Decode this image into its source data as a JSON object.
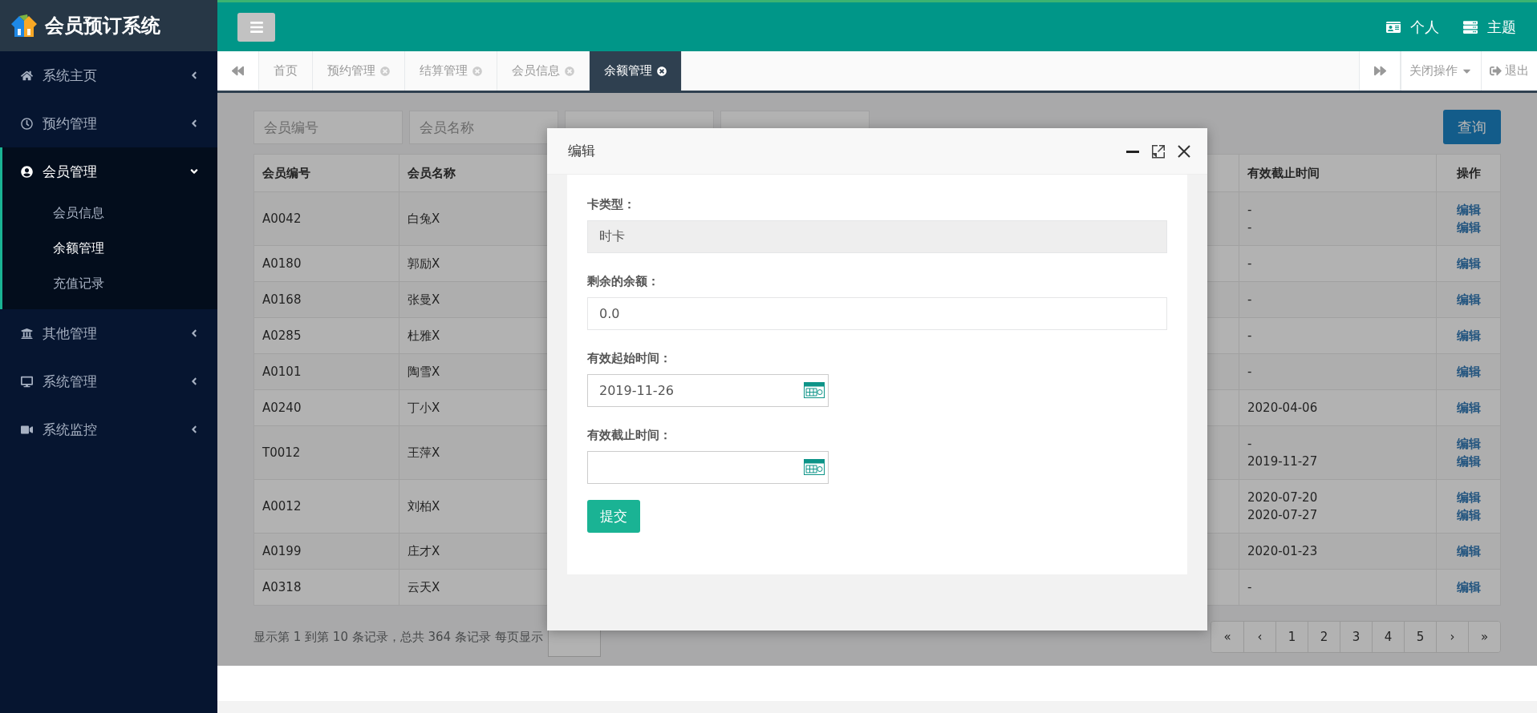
{
  "app": {
    "title": "会员预订系统"
  },
  "header": {
    "actions": [
      {
        "label": "个人"
      },
      {
        "label": "主题"
      }
    ]
  },
  "sidebar": {
    "items": [
      {
        "label": "系统主页",
        "expanded": false
      },
      {
        "label": "预约管理",
        "expanded": false
      },
      {
        "label": "会员管理",
        "expanded": true,
        "children": [
          {
            "label": "会员信息",
            "selected": false
          },
          {
            "label": "余额管理",
            "selected": true
          },
          {
            "label": "充值记录",
            "selected": false
          }
        ]
      },
      {
        "label": "其他管理",
        "expanded": false
      },
      {
        "label": "系统管理",
        "expanded": false
      },
      {
        "label": "系统监控",
        "expanded": false
      }
    ]
  },
  "tabs": [
    {
      "label": "首页",
      "closable": false,
      "selected": false
    },
    {
      "label": "预约管理",
      "closable": true,
      "selected": false
    },
    {
      "label": "结算管理",
      "closable": true,
      "selected": false
    },
    {
      "label": "会员信息",
      "closable": true,
      "selected": false
    },
    {
      "label": "余额管理",
      "closable": true,
      "selected": true
    }
  ],
  "tab_tools": {
    "close_menu": "关闭操作",
    "logout": "退出"
  },
  "search": {
    "fields": [
      {
        "placeholder": "会员编号"
      },
      {
        "placeholder": "会员名称"
      }
    ],
    "button": "查询"
  },
  "table": {
    "columns": [
      "会员编号",
      "会员名称",
      "有效截止时间",
      "操作"
    ],
    "rows": [
      {
        "id": "A0042",
        "name": "白兔X",
        "end_dates": [
          "-",
          "-"
        ],
        "actions": [
          "编辑",
          "编辑"
        ]
      },
      {
        "id": "A0180",
        "name": "郭励X",
        "end_dates": [
          "-"
        ],
        "actions": [
          "编辑"
        ]
      },
      {
        "id": "A0168",
        "name": "张曼X",
        "end_dates": [
          "-"
        ],
        "actions": [
          "编辑"
        ]
      },
      {
        "id": "A0285",
        "name": "杜雅X",
        "end_dates": [
          "-"
        ],
        "actions": [
          "编辑"
        ]
      },
      {
        "id": "A0101",
        "name": "陶雪X",
        "end_dates": [
          "-"
        ],
        "actions": [
          "编辑"
        ]
      },
      {
        "id": "A0240",
        "name": "丁小X",
        "end_dates": [
          "2020-04-06"
        ],
        "actions": [
          "编辑"
        ]
      },
      {
        "id": "T0012",
        "name": "王萍X",
        "end_dates": [
          "-",
          "2019-11-27"
        ],
        "actions": [
          "编辑",
          "编辑"
        ]
      },
      {
        "id": "A0012",
        "name": "刘柏X",
        "end_dates": [
          "2020-07-20",
          "2020-07-27"
        ],
        "actions": [
          "编辑",
          "编辑"
        ]
      },
      {
        "id": "A0199",
        "name": "庄才X",
        "end_dates": [
          "2020-01-23"
        ],
        "actions": [
          "编辑"
        ]
      },
      {
        "id": "A0318",
        "name": "云天X",
        "end_dates": [
          "-"
        ],
        "actions": [
          "编辑"
        ]
      }
    ]
  },
  "pagination": {
    "summary": "显示第 1 到第 10 条记录，总共 364 条记录 每页显示",
    "pages": [
      "«",
      "‹",
      "1",
      "2",
      "3",
      "4",
      "5",
      "›",
      "»"
    ]
  },
  "modal": {
    "title": "编辑",
    "fields": [
      {
        "kind": "text",
        "label": "卡类型：",
        "value": "时卡",
        "disabled": true
      },
      {
        "kind": "text",
        "label": "剩余的余额：",
        "value": "0.0",
        "disabled": false
      },
      {
        "kind": "date",
        "label": "有效起始时间：",
        "value": "2019-11-26"
      },
      {
        "kind": "date",
        "label": "有效截止时间："
      }
    ],
    "submit": "提交"
  }
}
